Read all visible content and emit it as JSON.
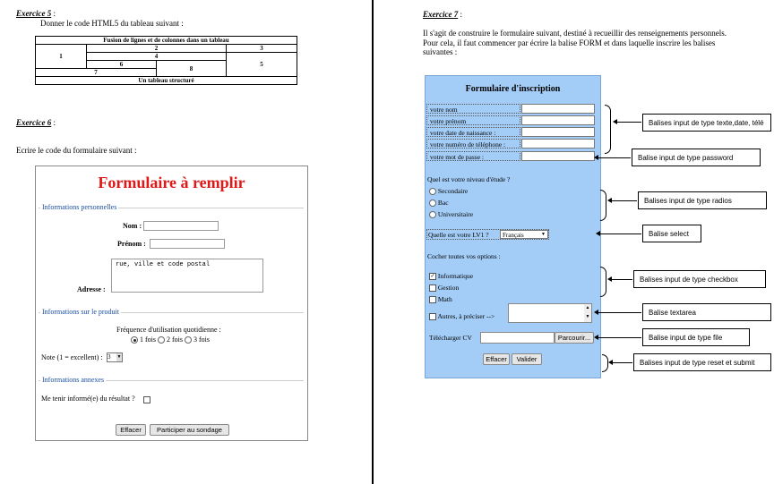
{
  "ex5": {
    "title": "Exercice 5",
    "colon": " :",
    "instruction": "Donner le code HTML5 du tableau suivant :",
    "table": {
      "caption": "Fusion de lignes et de colonnes dans un tableau",
      "c1": "1",
      "c2": "2",
      "c3": "3",
      "c4": "4",
      "c5": "5",
      "c6": "6",
      "c7": "7",
      "c8": "8",
      "footer": "Un tableau structuré"
    }
  },
  "ex6": {
    "title": "Exercice 6",
    "colon": " :",
    "instruction": "Ecrire le code du formulaire suivant :",
    "form": {
      "heading": "Formulaire à remplir",
      "legend1": "Informations personnelles",
      "nom": "Nom :",
      "prenom": "Prénom :",
      "adresse": "Adresse :",
      "address_text": "rue, ville et code postal",
      "legend2": "Informations sur le produit",
      "frequence": "Fréquence d'utilisation quotidienne :",
      "opt1": "1 fois",
      "opt2": "2 fois",
      "opt3": "3 fois",
      "note": "Note (1 = excellent) :",
      "note_value": "3",
      "legend3": "Informations annexes",
      "tenir": "Me tenir informé(e) du résultat ?",
      "btn_reset": "Effacer",
      "btn_submit": "Participer au sondage"
    }
  },
  "ex7": {
    "title": "Exercice 7",
    "colon": " :",
    "para1": "Il s'agit de construire le formulaire suivant, destiné à recueillir des renseignements personnels.",
    "para2": "Pour cela, il faut commencer par écrire la balise FORM et dans laquelle  inscrire les balises",
    "para3": "suivantes :",
    "form": {
      "heading": "Formulaire d'inscription",
      "rows": [
        "votre nom",
        "votre prénom",
        "votre date de naissance :",
        "votre numéro de téléphone :",
        "votre mot de passe :"
      ],
      "niveau": "Quel est votre niveau d'étude ?",
      "radios": [
        "Secondaire",
        "Bac",
        "Universitaire"
      ],
      "lv1": "Quelle est votre LV1 ?",
      "lv1_value": "Français",
      "cocher": "Cocher toutes vos options :",
      "checks": [
        "Informatique",
        "Gestion",
        "Math"
      ],
      "autres": "Autres, à préciser -->",
      "cv": "Télécharger CV",
      "parcourir": "Parcourir...",
      "btn_reset": "Effacer",
      "btn_submit": "Valider"
    },
    "annotations": {
      "a1": "Balises input de type texte,date, télé",
      "a2": "Balise input de type password",
      "a3": "Balises input de type radios",
      "a4": "Balise select",
      "a5": "Balises input de type checkbox",
      "a6": "Balise textarea",
      "a7": "Balise input de type file",
      "a8": "Balises input de type reset et submit"
    }
  }
}
